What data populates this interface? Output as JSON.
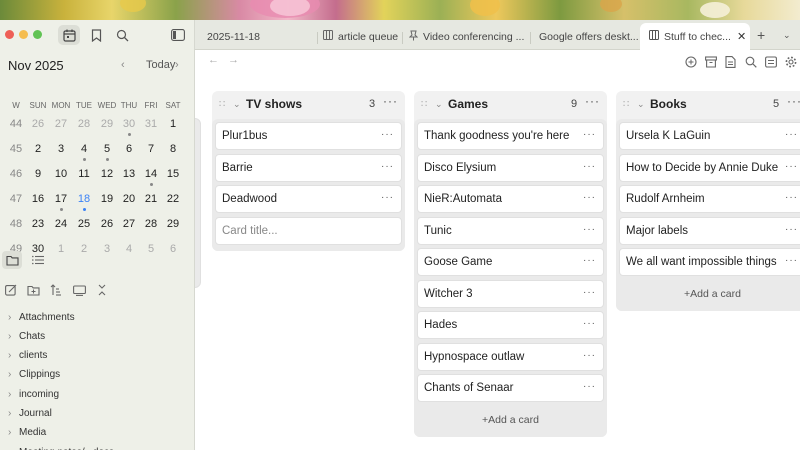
{
  "calendar": {
    "month_label": "Nov 2025",
    "today_label": "Today",
    "weekday_headers": [
      "W",
      "SUN",
      "MON",
      "TUE",
      "WED",
      "THU",
      "FRI",
      "SAT"
    ],
    "weeks": [
      {
        "num": "44",
        "days": [
          "26",
          "27",
          "28",
          "29",
          "30",
          "31",
          "1"
        ]
      },
      {
        "num": "45",
        "days": [
          "2",
          "3",
          "4",
          "5",
          "6",
          "7",
          "8"
        ]
      },
      {
        "num": "46",
        "days": [
          "9",
          "10",
          "11",
          "12",
          "13",
          "14",
          "15"
        ]
      },
      {
        "num": "47",
        "days": [
          "16",
          "17",
          "18",
          "19",
          "20",
          "21",
          "22"
        ]
      },
      {
        "num": "48",
        "days": [
          "23",
          "24",
          "25",
          "26",
          "27",
          "28",
          "29"
        ]
      },
      {
        "num": "49",
        "days": [
          "30",
          "1",
          "2",
          "3",
          "4",
          "5",
          "6"
        ]
      }
    ]
  },
  "folders": [
    "Attachments",
    "Chats",
    "clients",
    "Clippings",
    "incoming",
    "Journal",
    "Media",
    "Meeting notes/...docs"
  ],
  "tabs": [
    {
      "label": "2025-11-18",
      "icon": "none",
      "active": false
    },
    {
      "label": "article queue",
      "icon": "kanban-icon",
      "active": false
    },
    {
      "label": "Video conferencing ...",
      "icon": "pin-icon",
      "active": false
    },
    {
      "label": "Google offers deskt...",
      "icon": "none",
      "active": false
    },
    {
      "label": "Stuff to chec...",
      "icon": "kanban-icon",
      "active": true
    }
  ],
  "board": {
    "columns": [
      {
        "title": "TV shows",
        "count": "3",
        "cards": [
          "Plur1bus",
          "Barrie",
          "Deadwood"
        ],
        "input_placeholder": "Card title...",
        "add_label": ""
      },
      {
        "title": "Games",
        "count": "9",
        "cards": [
          "Thank goodness you're here",
          "Disco Elysium",
          "NieR:Automata",
          "Tunic",
          "Goose Game",
          "Witcher 3",
          "Hades",
          "Hypnospace outlaw",
          "Chants of Senaar"
        ],
        "input_placeholder": "",
        "add_label": "+Add a card"
      },
      {
        "title": "Books",
        "count": "5",
        "cards": [
          "Ursela K LaGuin",
          "How to Decide by Annie Duke",
          "Rudolf Arnheim",
          "Major labels",
          "We all want impossible things"
        ],
        "input_placeholder": "",
        "add_label": "+Add a card"
      }
    ]
  },
  "colors": {
    "accent": "#3b82f6",
    "sidebar_bg": "#eef0e8",
    "tabbar_bg": "#e6e8e1"
  }
}
